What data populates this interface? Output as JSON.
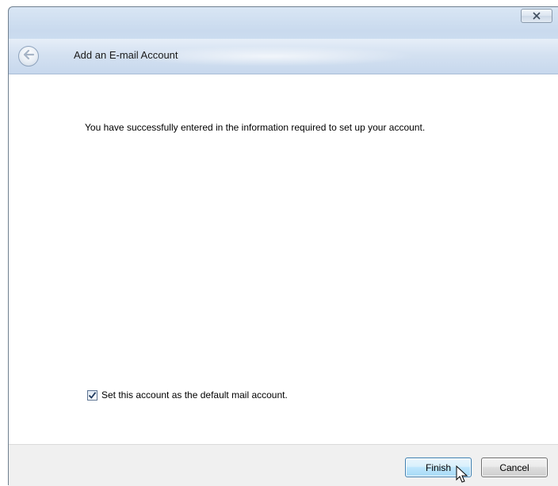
{
  "window": {
    "close_icon": "close-icon"
  },
  "header": {
    "back_icon": "back-arrow-icon",
    "title": "Add an E-mail Account"
  },
  "main": {
    "info_text": "You have successfully entered in the information required to set up your account.",
    "default_account": {
      "label": "Set this account as the default mail account.",
      "checked": true
    }
  },
  "footer": {
    "finish_label": "Finish",
    "cancel_label": "Cancel"
  },
  "colors": {
    "accent": "#3c7fb1",
    "header_gradient": "#c7d8ed"
  }
}
